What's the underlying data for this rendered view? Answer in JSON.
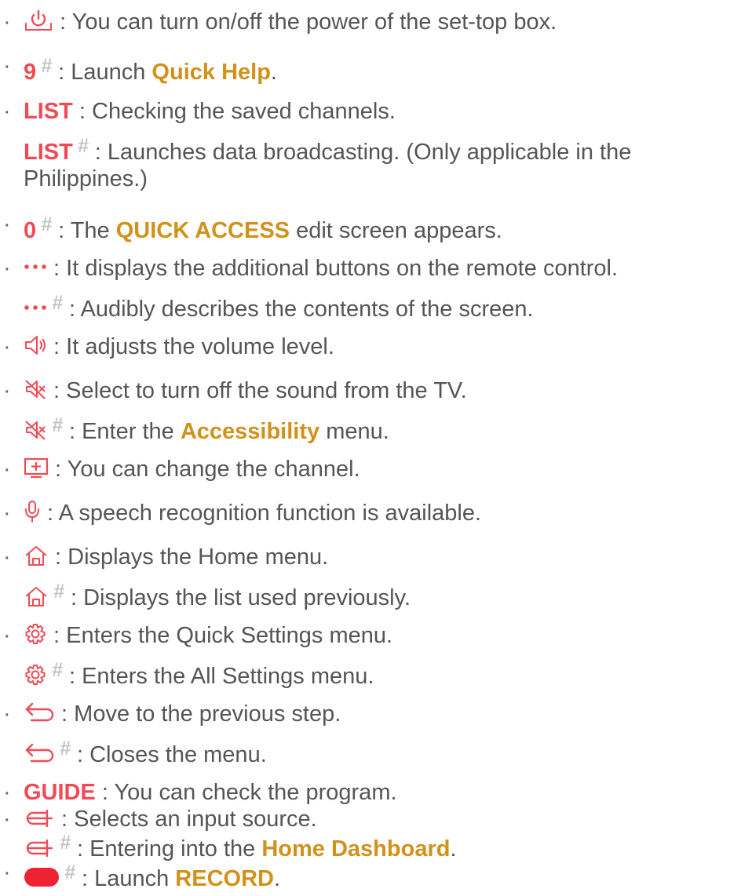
{
  "bullet": "·",
  "hash": "#",
  "colors": {
    "key": "#f04b55",
    "highlight": "#d1911a",
    "text": "#555555",
    "hash": "#c4c4c4"
  },
  "items": {
    "power": {
      "icon": "power-icon",
      "text": ": You can turn on/off the power of the set-top box."
    },
    "nine": {
      "key": "9",
      "pre": " : Launch ",
      "link": "Quick Help",
      "post": "."
    },
    "list": {
      "key": "LIST",
      "text": " : Checking the saved channels."
    },
    "list_hash": {
      "key": "LIST",
      "text1": " : Launches data broadcasting. (Only applicable in the",
      "text2": "Philippines.)"
    },
    "zero": {
      "key": "0",
      "pre": " : The ",
      "link": "QUICK ACCESS",
      "post": " edit screen appears."
    },
    "more": {
      "icon": "more-dots-icon",
      "text": " : It displays the additional buttons on the remote control."
    },
    "more_hash": {
      "text": " : Audibly describes the contents of the screen."
    },
    "volume": {
      "icon": "volume-icon",
      "text": " : It adjusts the volume level."
    },
    "mute": {
      "icon": "mute-icon",
      "text": " : Select to turn off the sound from the TV."
    },
    "mute_hash": {
      "pre": " : Enter the ",
      "link": "Accessibility",
      "post": " menu."
    },
    "channel": {
      "icon": "channel-icon",
      "text": " : You can change the channel."
    },
    "mic": {
      "icon": "microphone-icon",
      "text": " : A speech recognition function is available."
    },
    "home": {
      "icon": "home-icon",
      "text": " : Displays the Home menu."
    },
    "home_hash": {
      "text": " : Displays the list used previously."
    },
    "settings": {
      "icon": "gear-icon",
      "text": " : Enters the Quick Settings menu."
    },
    "settings_hash": {
      "text": " : Enters the All Settings menu."
    },
    "back": {
      "icon": "back-arrow-icon",
      "text": " : Move to the previous step."
    },
    "back_hash": {
      "text": " : Closes the menu."
    },
    "guide": {
      "key": "GUIDE",
      "text": " : You can check the program."
    },
    "input": {
      "icon": "input-source-icon",
      "text": " : Selects an input source."
    },
    "input_hash": {
      "pre": " : Entering into the ",
      "link": "Home Dashboard",
      "post": "."
    },
    "record": {
      "icon": "record-button-icon",
      "pre": " : Launch ",
      "link": "RECORD",
      "post": "."
    }
  }
}
